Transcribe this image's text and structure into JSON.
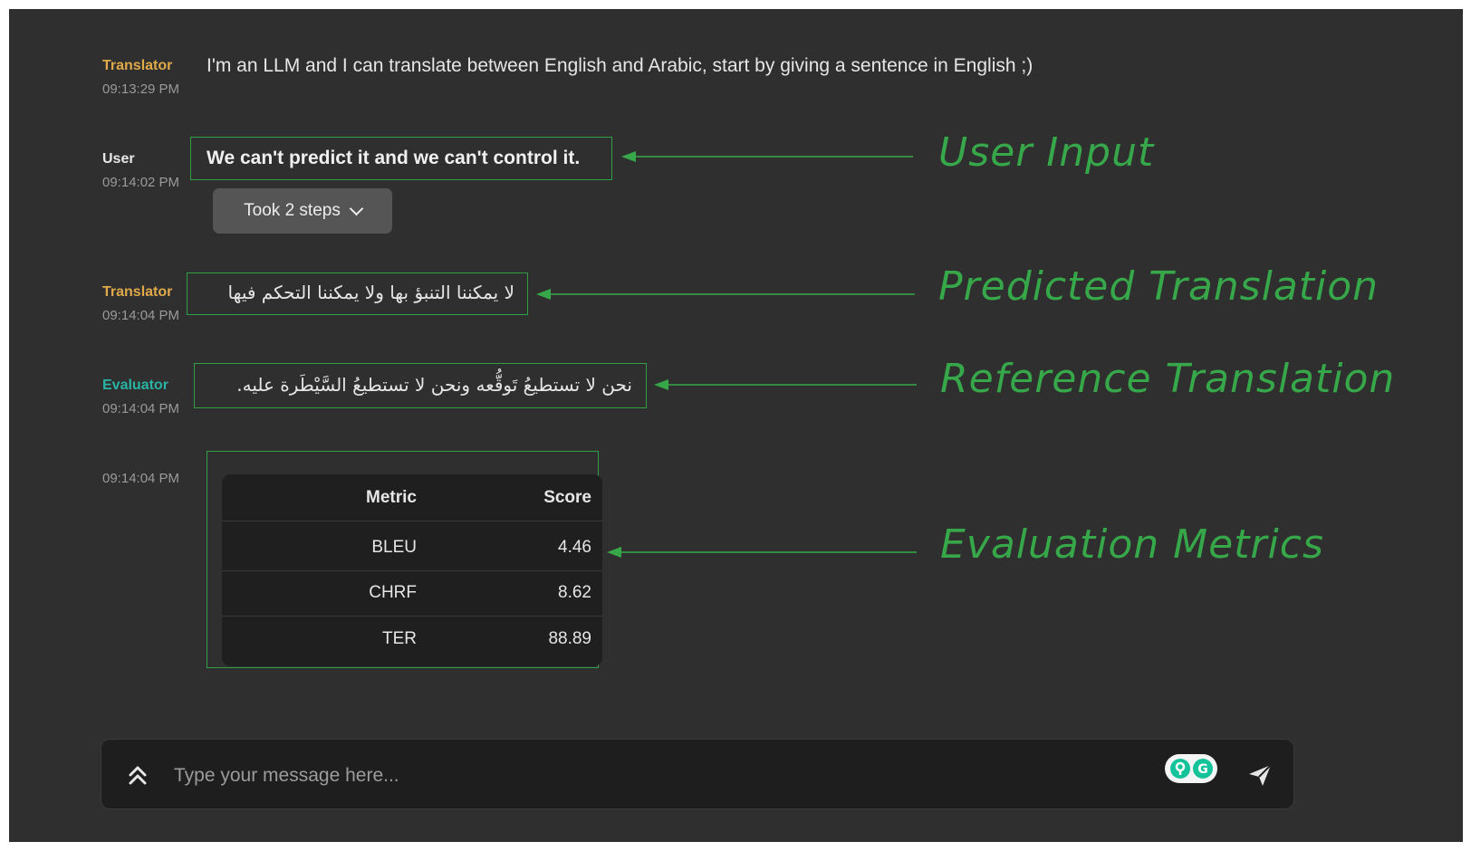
{
  "messages": [
    {
      "sender": "Translator",
      "time": "09:13:29 PM",
      "text": "I'm an LLM and I can translate between English and Arabic, start by giving a sentence in English ;)"
    },
    {
      "sender": "User",
      "time": "09:14:02 PM",
      "text": "We can't predict it and we can't control it.",
      "steps_label": "Took 2 steps"
    },
    {
      "sender": "Translator",
      "time": "09:14:04 PM",
      "text": "لا يمكننا التنبؤ بها ولا يمكننا التحكم فيها"
    },
    {
      "sender": "Evaluator",
      "time": "09:14:04 PM",
      "text": "نحن لا تستطيعُ تَوقُّعه ونحن لا تستطيعُ السَّيْطَرة عليه."
    },
    {
      "sender": "",
      "time": "09:14:04 PM"
    }
  ],
  "metrics_table": {
    "headers": [
      "Metric",
      "Score"
    ],
    "rows": [
      {
        "metric": "BLEU",
        "score": "4.46"
      },
      {
        "metric": "CHRF",
        "score": "8.62"
      },
      {
        "metric": "TER",
        "score": "88.89"
      }
    ]
  },
  "annotations": {
    "user_input": "User Input",
    "predicted": "Predicted Translation",
    "reference": "Reference Translation",
    "metrics": "Evaluation Metrics"
  },
  "composer": {
    "placeholder": "Type your message here..."
  },
  "icons": [
    "expand-icon",
    "chevron-down-icon",
    "grammarly-icon",
    "send-icon"
  ],
  "colors": {
    "annotation": "#37a84a",
    "translator": "#e0a94a",
    "evaluator": "#2ab3a5",
    "background": "#2f2f2f"
  }
}
